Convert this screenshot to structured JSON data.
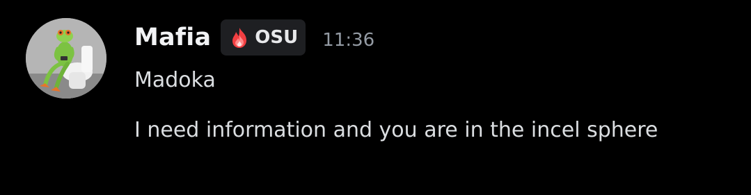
{
  "message": {
    "author": "Mafia",
    "tag": {
      "label": "OSU",
      "icon": "flame-icon",
      "icon_color": "#f23f42"
    },
    "timestamp": "11:36",
    "lines": [
      "Madoka",
      "I need information and you are in the incel sphere"
    ]
  },
  "colors": {
    "background": "#000000",
    "username": "#f2f3f5",
    "text": "#dbdee1",
    "timestamp": "#949ba4",
    "tag_background": "#1e1f22"
  },
  "avatar": {
    "icon": "frog-figurine-avatar"
  }
}
